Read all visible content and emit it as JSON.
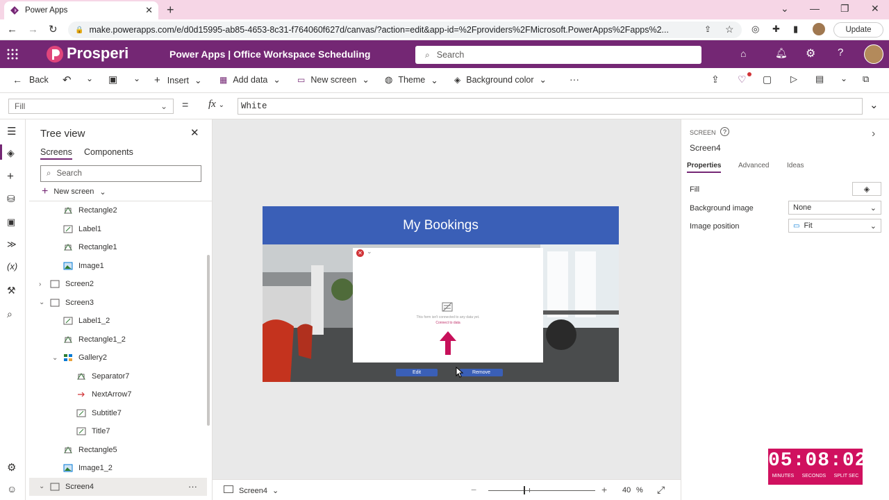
{
  "browser": {
    "tab_title": "Power Apps",
    "url": "make.powerapps.com/e/d0d15995-ab85-4653-8c31-f764060f627d/canvas/?action=edit&app-id=%2Fproviders%2FMicrosoft.PowerApps%2Fapps%2...",
    "update_label": "Update"
  },
  "header": {
    "logo_text": "Prosperi",
    "title": "Power Apps  |  Office Workspace Scheduling",
    "search_placeholder": "Search"
  },
  "commandbar": {
    "back": "Back",
    "insert": "Insert",
    "add_data": "Add data",
    "new_screen": "New screen",
    "theme": "Theme",
    "background_color": "Background color",
    "more": "···"
  },
  "formula_bar": {
    "property": "Fill",
    "equals": "=",
    "fx": "fx",
    "formula": "White"
  },
  "tree": {
    "title": "Tree view",
    "tab_screens": "Screens",
    "tab_components": "Components",
    "search_placeholder": "Search",
    "new_screen": "New screen",
    "items": [
      {
        "label": "Rectangle2",
        "icon": "shape-icon",
        "indent": 1
      },
      {
        "label": "Label1",
        "icon": "label-icon",
        "indent": 1
      },
      {
        "label": "Rectangle1",
        "icon": "shape-icon",
        "indent": 1
      },
      {
        "label": "Image1",
        "icon": "image-icon",
        "indent": 1
      },
      {
        "label": "Screen2",
        "icon": "screen-icon",
        "indent": 0,
        "expander": "collapsed"
      },
      {
        "label": "Screen3",
        "icon": "screen-icon",
        "indent": 0,
        "expander": "expanded"
      },
      {
        "label": "Label1_2",
        "icon": "label-icon",
        "indent": 1
      },
      {
        "label": "Rectangle1_2",
        "icon": "shape-icon",
        "indent": 1
      },
      {
        "label": "Gallery2",
        "icon": "gallery-icon",
        "indent": 1,
        "expander": "expanded"
      },
      {
        "label": "Separator7",
        "icon": "shape-icon",
        "indent": 2
      },
      {
        "label": "NextArrow7",
        "icon": "arrow-icon",
        "indent": 2
      },
      {
        "label": "Subtitle7",
        "icon": "label-icon",
        "indent": 2
      },
      {
        "label": "Title7",
        "icon": "label-icon",
        "indent": 2
      },
      {
        "label": "Rectangle5",
        "icon": "shape-icon",
        "indent": 1
      },
      {
        "label": "Image1_2",
        "icon": "image-icon",
        "indent": 1
      },
      {
        "label": "Screen4",
        "icon": "screen-icon",
        "indent": 0,
        "expander": "expanded",
        "selected": true
      }
    ],
    "selected_more": "···"
  },
  "canvas": {
    "screen_title": "My Bookings",
    "form_line1": "This form isn't connected to any data yet.",
    "form_line2": "Connect to data",
    "edit_label": "Edit",
    "remove_label": "Remove"
  },
  "statusbar": {
    "screen_name": "Screen4",
    "zoom_value": "40",
    "zoom_unit": "%",
    "zoom_fraction": 0.4
  },
  "properties": {
    "kind": "SCREEN",
    "name": "Screen4",
    "tabs": [
      "Properties",
      "Advanced",
      "Ideas"
    ],
    "fill_label": "Fill",
    "bg_image_label": "Background image",
    "bg_image_value": "None",
    "img_pos_label": "Image position",
    "img_pos_value": "Fit"
  },
  "timer": {
    "time": "05:08:02",
    "minutes": "MINUTES",
    "seconds": "SECONDS",
    "split": "SPLIT SEC"
  },
  "colors": {
    "app_header": "#742774",
    "accent": "#3a5fb7",
    "timer": "#d0115f",
    "tab_bar": "#f6d6e6"
  }
}
